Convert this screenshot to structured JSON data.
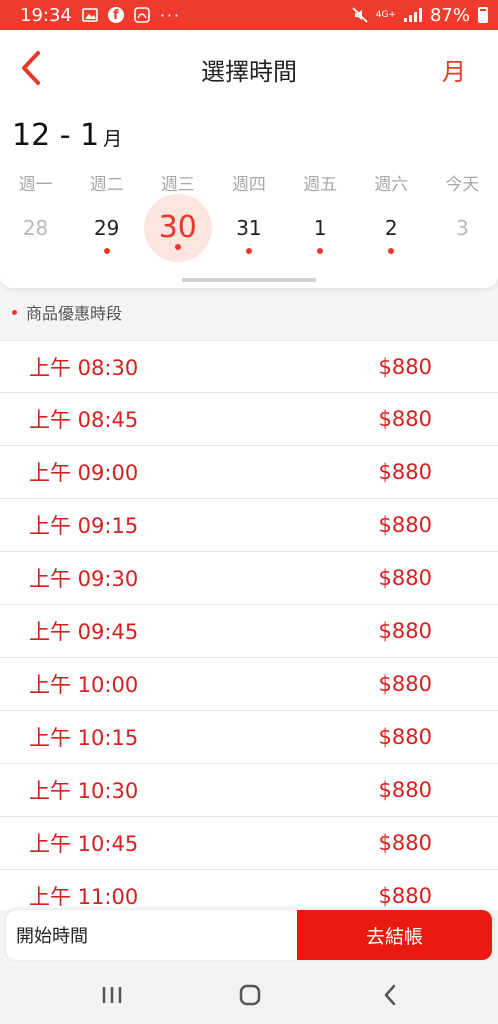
{
  "status_bar": {
    "time": "19:34",
    "network": "4G+",
    "battery": "87%",
    "notification_icons": [
      "gallery-icon",
      "facebook-icon",
      "app-icon"
    ],
    "more": "···"
  },
  "header": {
    "title": "選擇時間",
    "month_button": "月"
  },
  "calendar": {
    "month_range": "12 - 1",
    "month_unit": "月",
    "days": [
      {
        "weekday": "週一",
        "date": "28",
        "muted": true,
        "dot": false
      },
      {
        "weekday": "週二",
        "date": "29",
        "muted": false,
        "dot": true
      },
      {
        "weekday": "週三",
        "date": "30",
        "muted": false,
        "dot": true,
        "selected": true
      },
      {
        "weekday": "週四",
        "date": "31",
        "muted": false,
        "dot": true
      },
      {
        "weekday": "週五",
        "date": "1",
        "muted": false,
        "dot": true
      },
      {
        "weekday": "週六",
        "date": "2",
        "muted": false,
        "dot": true
      },
      {
        "weekday": "今天",
        "date": "3",
        "muted": true,
        "dot": false
      }
    ]
  },
  "section_label": "商品優惠時段",
  "time_slots": [
    {
      "time": "上午 08:30",
      "price": "$880"
    },
    {
      "time": "上午 08:45",
      "price": "$880"
    },
    {
      "time": "上午 09:00",
      "price": "$880"
    },
    {
      "time": "上午 09:15",
      "price": "$880"
    },
    {
      "time": "上午 09:30",
      "price": "$880"
    },
    {
      "time": "上午 09:45",
      "price": "$880"
    },
    {
      "time": "上午 10:00",
      "price": "$880"
    },
    {
      "time": "上午 10:15",
      "price": "$880"
    },
    {
      "time": "上午 10:30",
      "price": "$880"
    },
    {
      "time": "上午 10:45",
      "price": "$880"
    },
    {
      "time": "上午 11:00",
      "price": "$880"
    }
  ],
  "bottom_bar": {
    "start_time_label": "開始時間",
    "checkout_label": "去結帳"
  },
  "colors": {
    "accent": "#e8372b",
    "status_bar": "#ee3b2e",
    "checkout": "#ea1a10",
    "selected_bg": "#fde4df"
  }
}
